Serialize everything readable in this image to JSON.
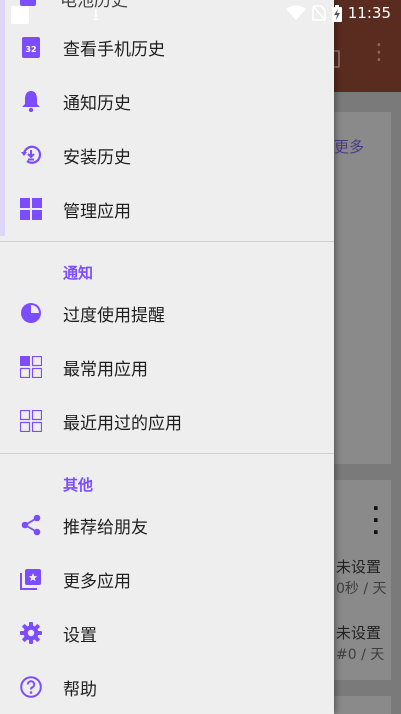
{
  "status_bar": {
    "time": "11:35"
  },
  "background": {
    "more_link": "更多",
    "rows": [
      {
        "title": "未设置",
        "subtitle": "0秒 / 天"
      },
      {
        "title": "未设置",
        "subtitle": "#0 / 天"
      }
    ]
  },
  "drawer": {
    "partial_item": "电池历史",
    "items_top": [
      {
        "label": "查看手机历史",
        "icon": "calendar-32-icon"
      },
      {
        "label": "通知历史",
        "icon": "bell-icon"
      },
      {
        "label": "安装历史",
        "icon": "history-download-icon"
      },
      {
        "label": "管理应用",
        "icon": "grid-apps-icon"
      }
    ],
    "section_notify": "通知",
    "items_notify": [
      {
        "label": "过度使用提醒",
        "icon": "pie-chart-icon"
      },
      {
        "label": "最常用应用",
        "icon": "grid-half-filled-icon"
      },
      {
        "label": "最近用过的应用",
        "icon": "grid-outline-icon"
      }
    ],
    "section_other": "其他",
    "items_other": [
      {
        "label": "推荐给朋友",
        "icon": "share-icon"
      },
      {
        "label": "更多应用",
        "icon": "more-apps-icon"
      },
      {
        "label": "设置",
        "icon": "gear-icon"
      },
      {
        "label": "帮助",
        "icon": "help-icon"
      }
    ]
  },
  "colors": {
    "accent": "#7c4dff",
    "drawer_bg": "#eeeeee",
    "appbar": "#5a2c1f"
  }
}
